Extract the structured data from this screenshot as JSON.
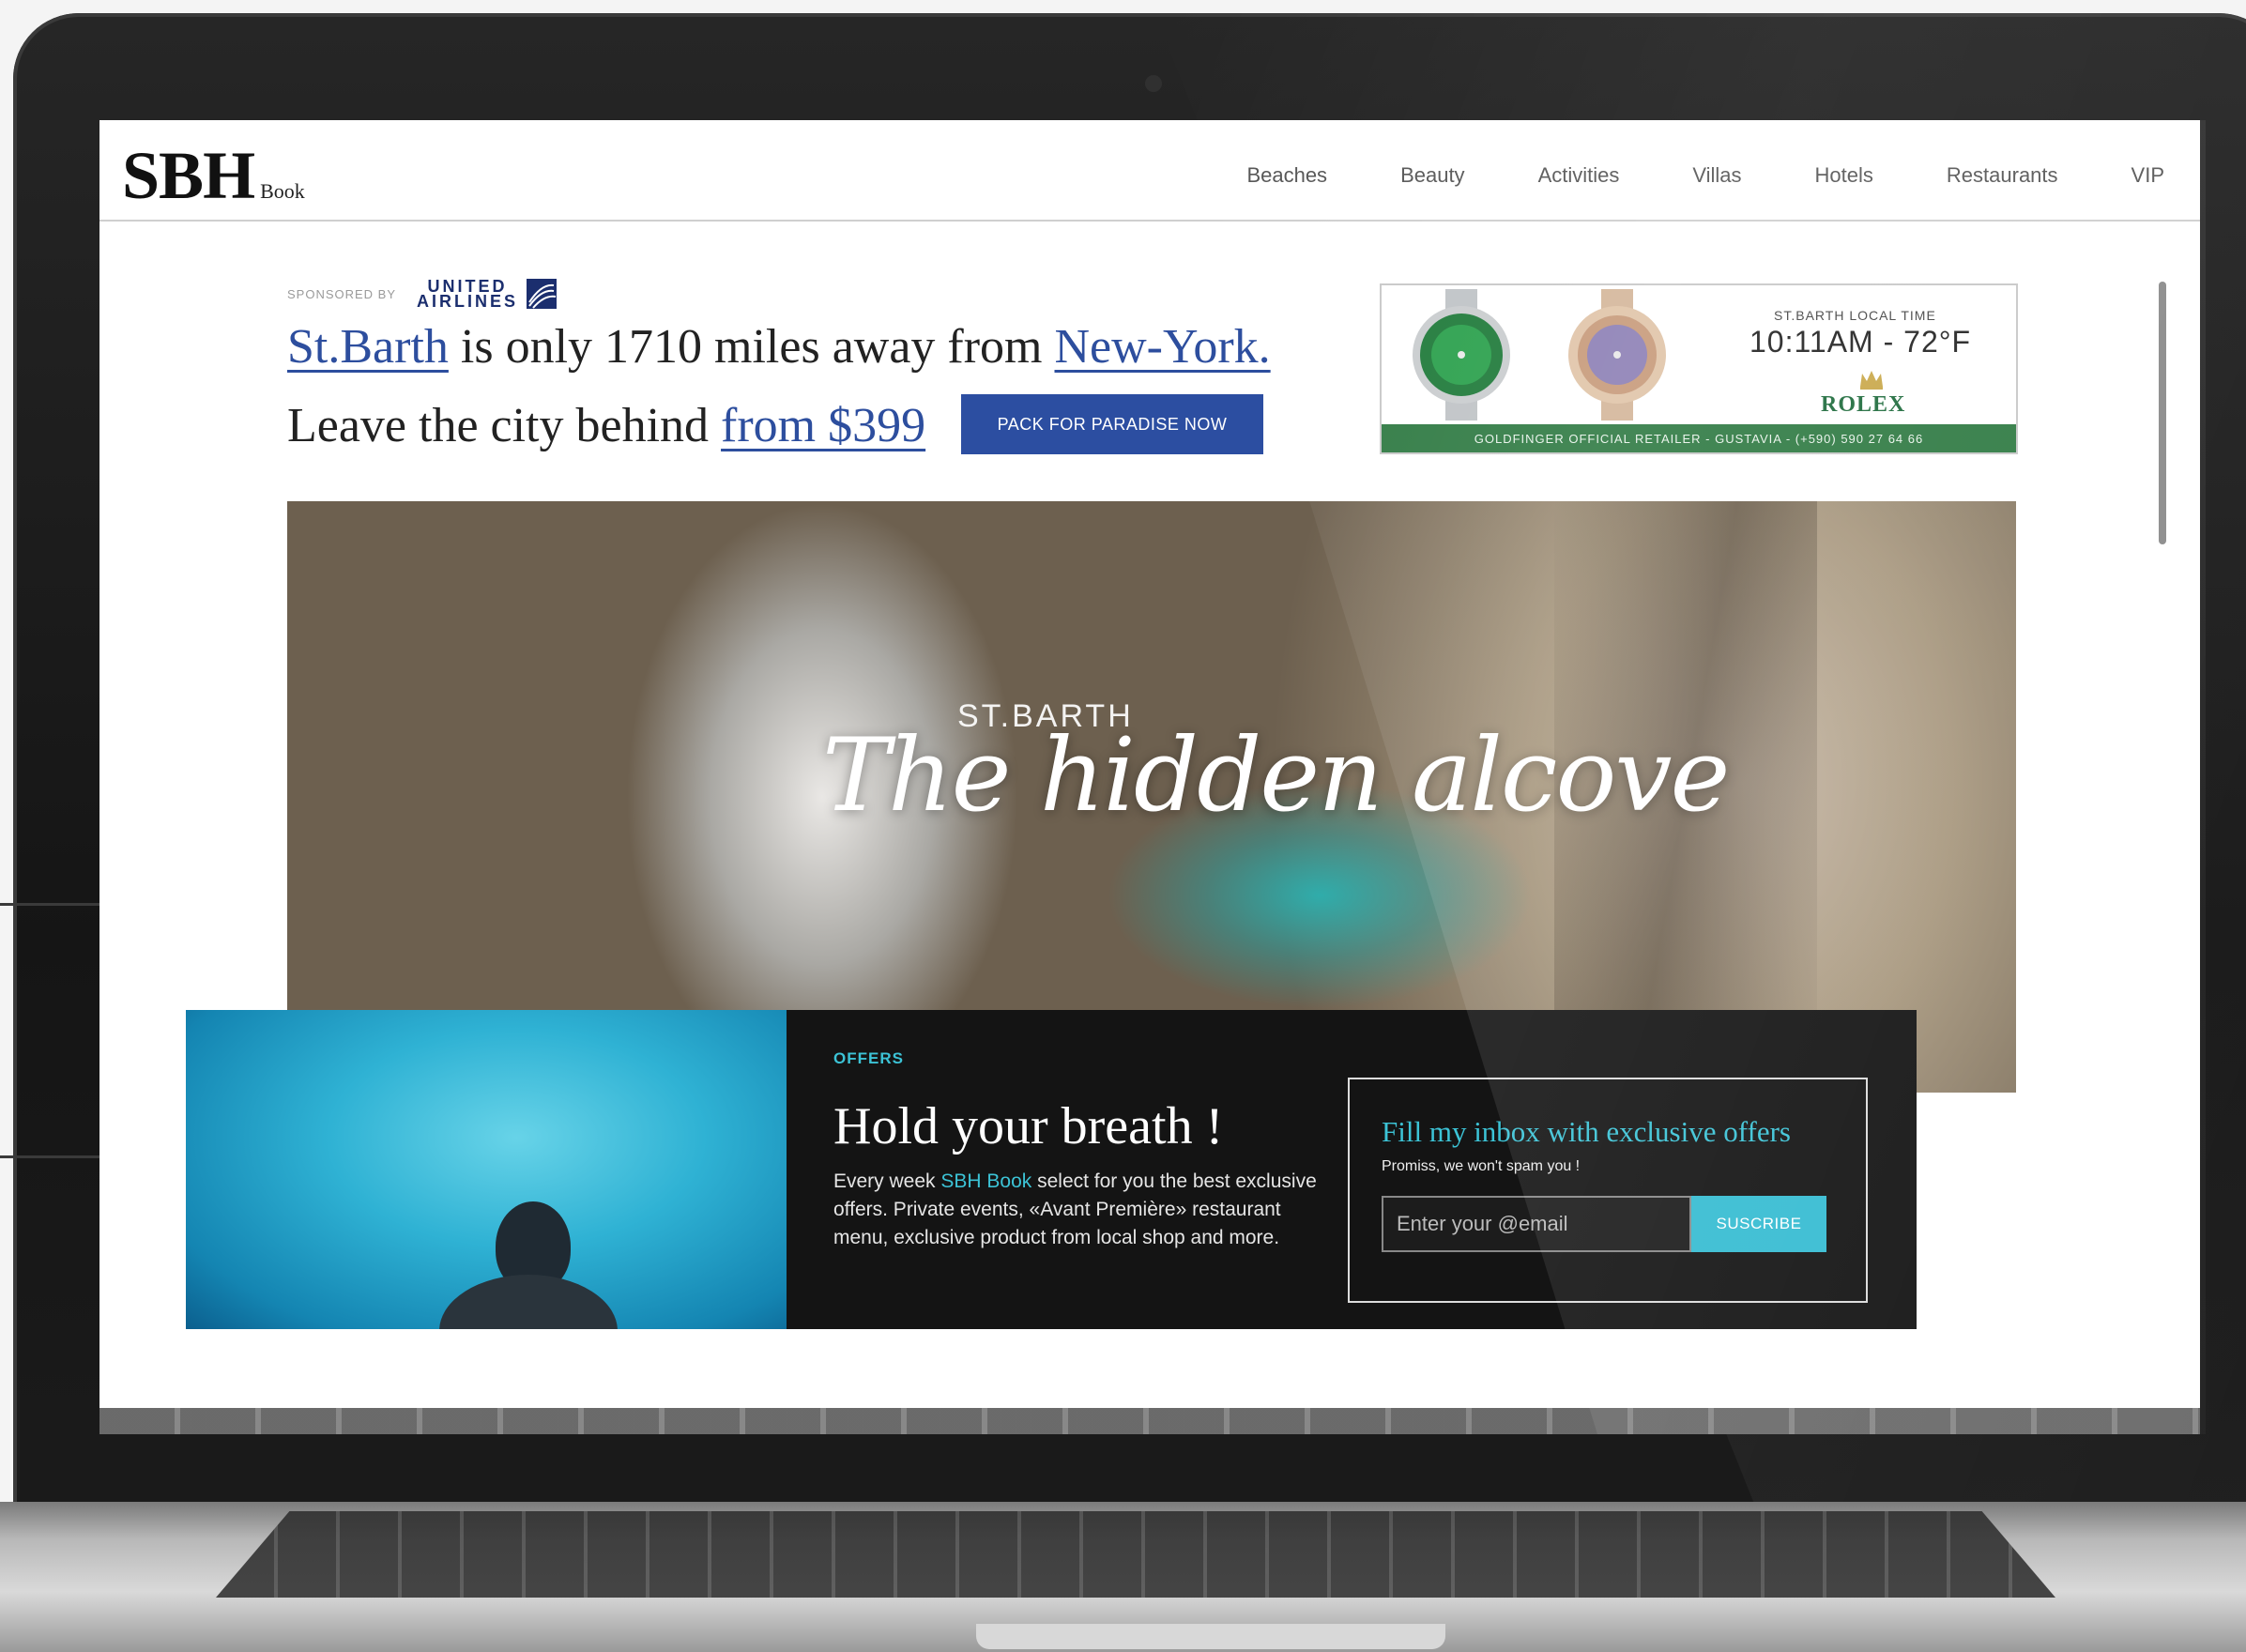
{
  "nav": {
    "logo_main": "SBH",
    "logo_sub": "Book",
    "items": [
      "Beaches",
      "Beauty",
      "Activities",
      "Villas",
      "Hotels",
      "Restaurants",
      "VIP"
    ]
  },
  "sponsor": {
    "label": "SPONSORED BY",
    "brand_line1": "UNITED",
    "brand_line2": "AIRLINES"
  },
  "headline": {
    "link_origin": "St.Barth",
    "middle": " is only 1710 miles away from ",
    "link_dest": "New-York.",
    "line2_text": "Leave the city behind ",
    "line2_link": "from $399"
  },
  "cta": {
    "label": "PACK FOR PARADISE NOW"
  },
  "ad": {
    "time_label": "ST.BARTH LOCAL TIME",
    "time_value": "10:11AM - 72°F",
    "brand": "ROLEX",
    "footer": "GOLDFINGER OFFICIAL RETAILER - GUSTAVIA - (+590) 590 27 64 66"
  },
  "hero": {
    "kicker": "ST.BARTH",
    "title": "The hidden alcove"
  },
  "offers": {
    "tag": "OFFERS",
    "title": "Hold your breath !",
    "body_pre": "Every week ",
    "body_highlight": "SBH Book",
    "body_post": " select for you the best exclusive offers. Private events, «Avant Première» restaurant menu, exclusive product from local shop and more."
  },
  "newsletter": {
    "title": "Fill my inbox with exclusive offers",
    "subtitle": "Promiss, we won't spam you !",
    "placeholder": "Enter your @email",
    "button": "SUSCRIBE"
  },
  "colors": {
    "link_blue": "#2d4e9e",
    "cta_blue": "#2c4ea1",
    "accent_cyan": "#3cc3d6",
    "rolex_green": "#2f7a43",
    "panel_dark": "#141414"
  }
}
